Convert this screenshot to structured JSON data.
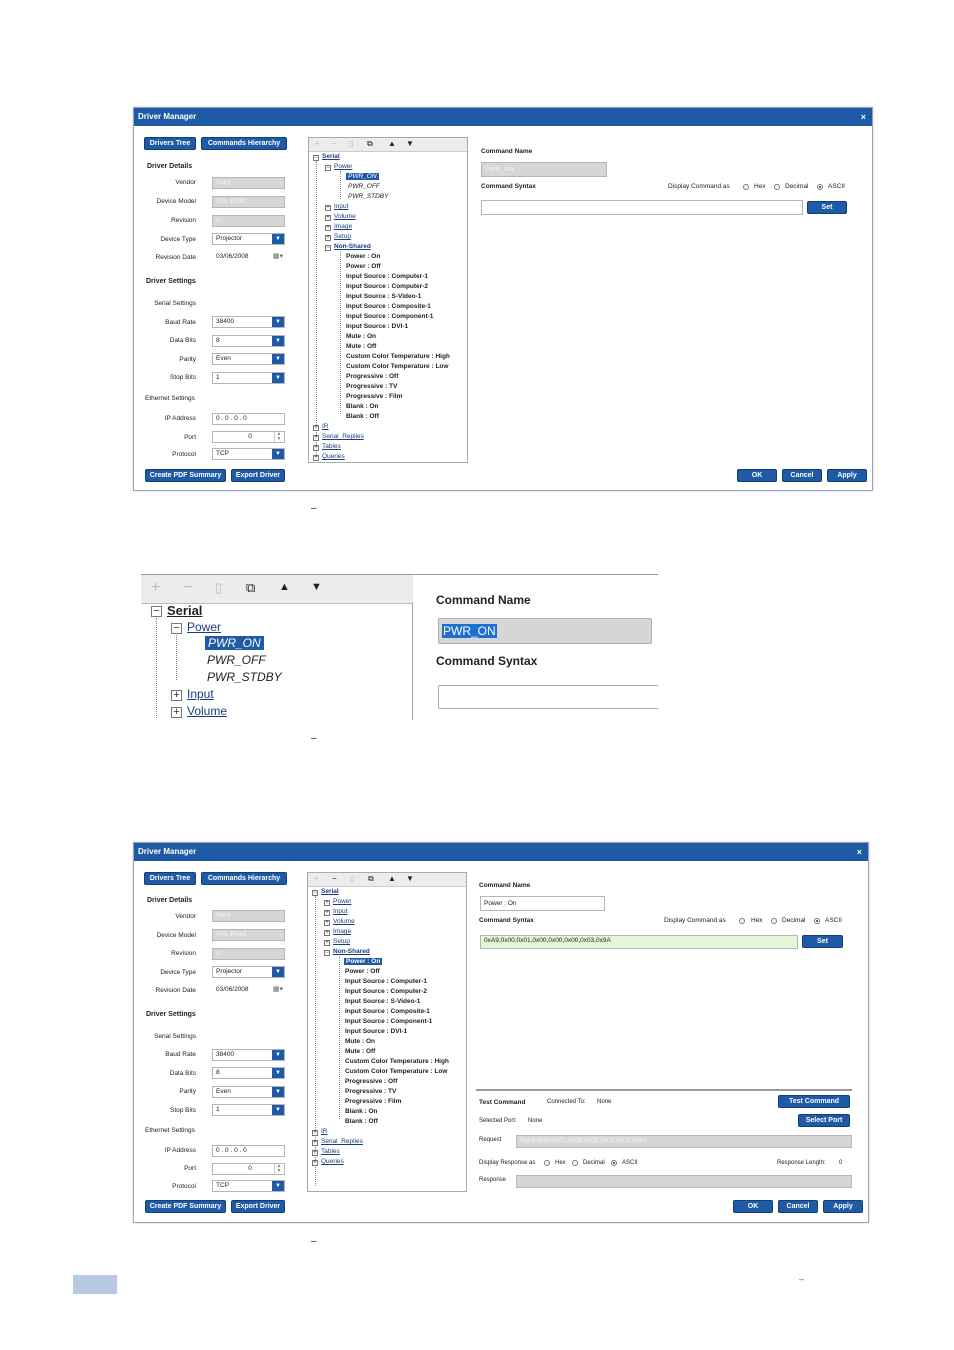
{
  "win": {
    "title": "Driver Manager",
    "close": "×",
    "tab_drivers": "Drivers Tree",
    "tab_commands": "Commands Hierarchy",
    "driver_details": "Driver Details",
    "vendor_label": "Vendor",
    "vendor": "Sony",
    "model_label": "Device Model",
    "model": "VPL-PX41",
    "revision_label": "Revision",
    "revision": "A",
    "type_label": "Device Type",
    "type": "Projector",
    "date_label": "Revision Date",
    "date": "03/06/2008",
    "driver_settings": "Driver Settings",
    "serial_settings": "Serial Settings",
    "baud_label": "Baud Rate",
    "baud": "38400",
    "databits_label": "Data Bits",
    "databits": "8",
    "parity_label": "Parity",
    "parity": "Even",
    "stopbits_label": "Stop Bits",
    "stopbits": "1",
    "ethernet_settings": "Ethernet Settings",
    "ip_label": "IP Address",
    "ip": "0  .  0  .  0  .  0",
    "port_label": "Port",
    "port": "0",
    "protocol_label": "Protocol",
    "protocol": "TCP",
    "create_pdf": "Create PDF Summary",
    "export_driver": "Export Driver",
    "cmd_name_label": "Command Name",
    "cmd_syntax_label": "Command Syntax",
    "display_as": "Display Command as",
    "hex": "Hex",
    "decimal": "Decimal",
    "ascii": "ASCII",
    "set": "Set",
    "ok": "OK",
    "cancel": "Cancel",
    "apply": "Apply"
  },
  "tree": {
    "serial": "Serial",
    "power": "Power",
    "pwr_on": "PWR_ON",
    "pwr_off": "PWR_OFF",
    "pwr_stdby": "PWR_STDBY",
    "input": "Input",
    "volume": "Volume",
    "image": "Image",
    "setup": "Setup",
    "non_shared": "Non-Shared",
    "non_shared_items": [
      "Power : On",
      "Power : Off",
      "Input Source : Computer-1",
      "Input Source : Computer-2",
      "Input Source : S-Video-1",
      "Input Source : Composite-1",
      "Input Source : Component-1",
      "Input Source : DVI-1",
      "Mute : On",
      "Mute : Off",
      "Custom Color Temperature : High",
      "Custom Color Temperature : Low",
      "Progressive : Off",
      "Progressive : TV",
      "Progressive : Film",
      "Blank : On",
      "Blank : Off"
    ],
    "ir": "IR",
    "serial_replies": "Serial_Replies",
    "tables": "Tables",
    "queries": "Queries"
  },
  "shot1": {
    "cmd_name_value": "PWR_ON",
    "cmd_syntax_value": ""
  },
  "shot3": {
    "cmd_name_value": "Power : On",
    "cmd_syntax_value": "0xA9,0x00,0x01,0x00,0x00,0x00,0x03,0x9A",
    "test_command_label": "Test Command",
    "connected_to_label": "Connected To:",
    "connected_to_value": "None",
    "test_command_button": "Test Command",
    "selected_port_label": "Selected Port:",
    "selected_port_value": "None",
    "select_port_button": "Select Port",
    "request_label": "Request",
    "request_value": "0xA9,0x00,0x01,0x00,0x00,0x00,0x03,0x9A",
    "display_response_as": "Display Response as",
    "response_length_label": "Response Length:",
    "response_length_value": "0",
    "response_label": "Response",
    "response_value": ""
  },
  "captions": {
    "dash": "–"
  }
}
